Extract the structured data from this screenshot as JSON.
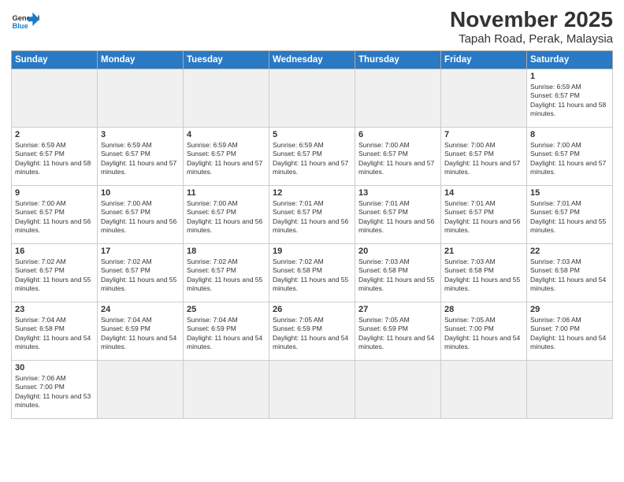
{
  "header": {
    "logo_general": "General",
    "logo_blue": "Blue",
    "title": "November 2025",
    "subtitle": "Tapah Road, Perak, Malaysia"
  },
  "weekdays": [
    "Sunday",
    "Monday",
    "Tuesday",
    "Wednesday",
    "Thursday",
    "Friday",
    "Saturday"
  ],
  "days": [
    {
      "num": "",
      "empty": true
    },
    {
      "num": "",
      "empty": true
    },
    {
      "num": "",
      "empty": true
    },
    {
      "num": "",
      "empty": true
    },
    {
      "num": "",
      "empty": true
    },
    {
      "num": "",
      "empty": true
    },
    {
      "num": "1",
      "sunrise": "6:59 AM",
      "sunset": "6:57 PM",
      "daylight": "11 hours and 58 minutes."
    },
    {
      "num": "2",
      "sunrise": "6:59 AM",
      "sunset": "6:57 PM",
      "daylight": "11 hours and 58 minutes."
    },
    {
      "num": "3",
      "sunrise": "6:59 AM",
      "sunset": "6:57 PM",
      "daylight": "11 hours and 57 minutes."
    },
    {
      "num": "4",
      "sunrise": "6:59 AM",
      "sunset": "6:57 PM",
      "daylight": "11 hours and 57 minutes."
    },
    {
      "num": "5",
      "sunrise": "6:59 AM",
      "sunset": "6:57 PM",
      "daylight": "11 hours and 57 minutes."
    },
    {
      "num": "6",
      "sunrise": "7:00 AM",
      "sunset": "6:57 PM",
      "daylight": "11 hours and 57 minutes."
    },
    {
      "num": "7",
      "sunrise": "7:00 AM",
      "sunset": "6:57 PM",
      "daylight": "11 hours and 57 minutes."
    },
    {
      "num": "8",
      "sunrise": "7:00 AM",
      "sunset": "6:57 PM",
      "daylight": "11 hours and 57 minutes."
    },
    {
      "num": "9",
      "sunrise": "7:00 AM",
      "sunset": "6:57 PM",
      "daylight": "11 hours and 56 minutes."
    },
    {
      "num": "10",
      "sunrise": "7:00 AM",
      "sunset": "6:57 PM",
      "daylight": "11 hours and 56 minutes."
    },
    {
      "num": "11",
      "sunrise": "7:00 AM",
      "sunset": "6:57 PM",
      "daylight": "11 hours and 56 minutes."
    },
    {
      "num": "12",
      "sunrise": "7:01 AM",
      "sunset": "6:57 PM",
      "daylight": "11 hours and 56 minutes."
    },
    {
      "num": "13",
      "sunrise": "7:01 AM",
      "sunset": "6:57 PM",
      "daylight": "11 hours and 56 minutes."
    },
    {
      "num": "14",
      "sunrise": "7:01 AM",
      "sunset": "6:57 PM",
      "daylight": "11 hours and 56 minutes."
    },
    {
      "num": "15",
      "sunrise": "7:01 AM",
      "sunset": "6:57 PM",
      "daylight": "11 hours and 55 minutes."
    },
    {
      "num": "16",
      "sunrise": "7:02 AM",
      "sunset": "6:57 PM",
      "daylight": "11 hours and 55 minutes."
    },
    {
      "num": "17",
      "sunrise": "7:02 AM",
      "sunset": "6:57 PM",
      "daylight": "11 hours and 55 minutes."
    },
    {
      "num": "18",
      "sunrise": "7:02 AM",
      "sunset": "6:57 PM",
      "daylight": "11 hours and 55 minutes."
    },
    {
      "num": "19",
      "sunrise": "7:02 AM",
      "sunset": "6:58 PM",
      "daylight": "11 hours and 55 minutes."
    },
    {
      "num": "20",
      "sunrise": "7:03 AM",
      "sunset": "6:58 PM",
      "daylight": "11 hours and 55 minutes."
    },
    {
      "num": "21",
      "sunrise": "7:03 AM",
      "sunset": "6:58 PM",
      "daylight": "11 hours and 55 minutes."
    },
    {
      "num": "22",
      "sunrise": "7:03 AM",
      "sunset": "6:58 PM",
      "daylight": "11 hours and 54 minutes."
    },
    {
      "num": "23",
      "sunrise": "7:04 AM",
      "sunset": "6:58 PM",
      "daylight": "11 hours and 54 minutes."
    },
    {
      "num": "24",
      "sunrise": "7:04 AM",
      "sunset": "6:59 PM",
      "daylight": "11 hours and 54 minutes."
    },
    {
      "num": "25",
      "sunrise": "7:04 AM",
      "sunset": "6:59 PM",
      "daylight": "11 hours and 54 minutes."
    },
    {
      "num": "26",
      "sunrise": "7:05 AM",
      "sunset": "6:59 PM",
      "daylight": "11 hours and 54 minutes."
    },
    {
      "num": "27",
      "sunrise": "7:05 AM",
      "sunset": "6:59 PM",
      "daylight": "11 hours and 54 minutes."
    },
    {
      "num": "28",
      "sunrise": "7:05 AM",
      "sunset": "7:00 PM",
      "daylight": "11 hours and 54 minutes."
    },
    {
      "num": "29",
      "sunrise": "7:06 AM",
      "sunset": "7:00 PM",
      "daylight": "11 hours and 54 minutes."
    },
    {
      "num": "30",
      "sunrise": "7:06 AM",
      "sunset": "7:00 PM",
      "daylight": "11 hours and 53 minutes."
    },
    {
      "num": "",
      "empty": true
    },
    {
      "num": "",
      "empty": true
    },
    {
      "num": "",
      "empty": true
    },
    {
      "num": "",
      "empty": true
    },
    {
      "num": "",
      "empty": true
    },
    {
      "num": "",
      "empty": true
    }
  ]
}
